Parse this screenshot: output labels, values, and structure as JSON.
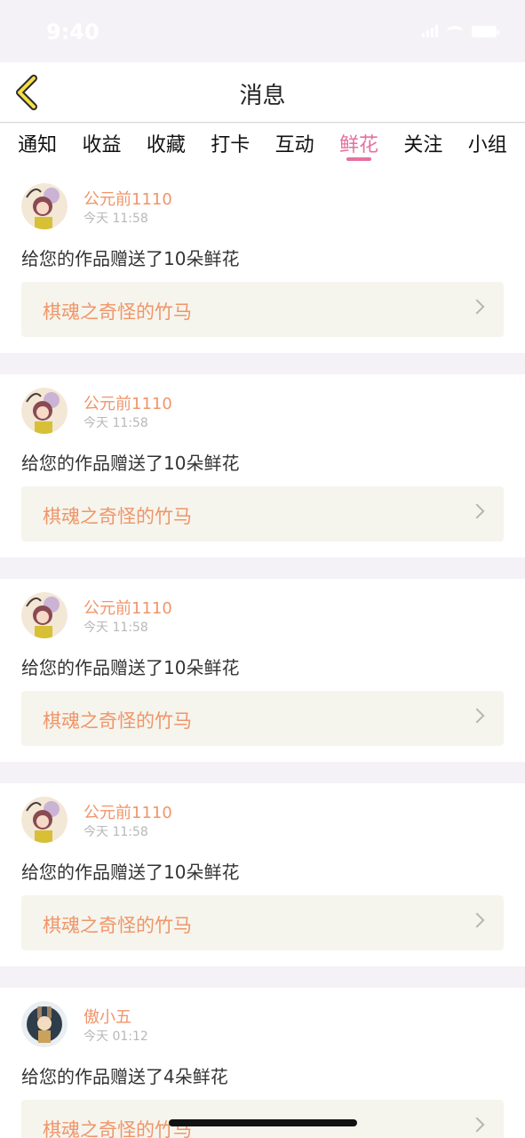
{
  "status_bar": {
    "time": "9:40"
  },
  "nav": {
    "title": "消息"
  },
  "tabs": [
    {
      "label": "通知",
      "active": false
    },
    {
      "label": "收益",
      "active": false
    },
    {
      "label": "收藏",
      "active": false
    },
    {
      "label": "打卡",
      "active": false
    },
    {
      "label": "互动",
      "active": false
    },
    {
      "label": "鲜花",
      "active": true
    },
    {
      "label": "关注",
      "active": false
    },
    {
      "label": "小组",
      "active": false
    }
  ],
  "messages": [
    {
      "user": "公元前1110",
      "time": "今天 11:58",
      "text": "给您的作品赠送了10朵鲜花",
      "work": "棋魂之奇怪的竹马",
      "avatar": "avatar-girl"
    },
    {
      "user": "公元前1110",
      "time": "今天 11:58",
      "text": "给您的作品赠送了10朵鲜花",
      "work": "棋魂之奇怪的竹马",
      "avatar": "avatar-girl"
    },
    {
      "user": "公元前1110",
      "time": "今天 11:58",
      "text": "给您的作品赠送了10朵鲜花",
      "work": "棋魂之奇怪的竹马",
      "avatar": "avatar-girl"
    },
    {
      "user": "公元前1110",
      "time": "今天 11:58",
      "text": "给您的作品赠送了10朵鲜花",
      "work": "棋魂之奇怪的竹马",
      "avatar": "avatar-girl"
    },
    {
      "user": "傲小五",
      "time": "今天 01:12",
      "text": "给您的作品赠送了4朵鲜花",
      "work": "棋魂之奇怪的竹马",
      "avatar": "avatar-bunny"
    }
  ],
  "colors": {
    "accent": "#e570a0",
    "name": "#f0956a",
    "background": "#f4f2f7"
  }
}
